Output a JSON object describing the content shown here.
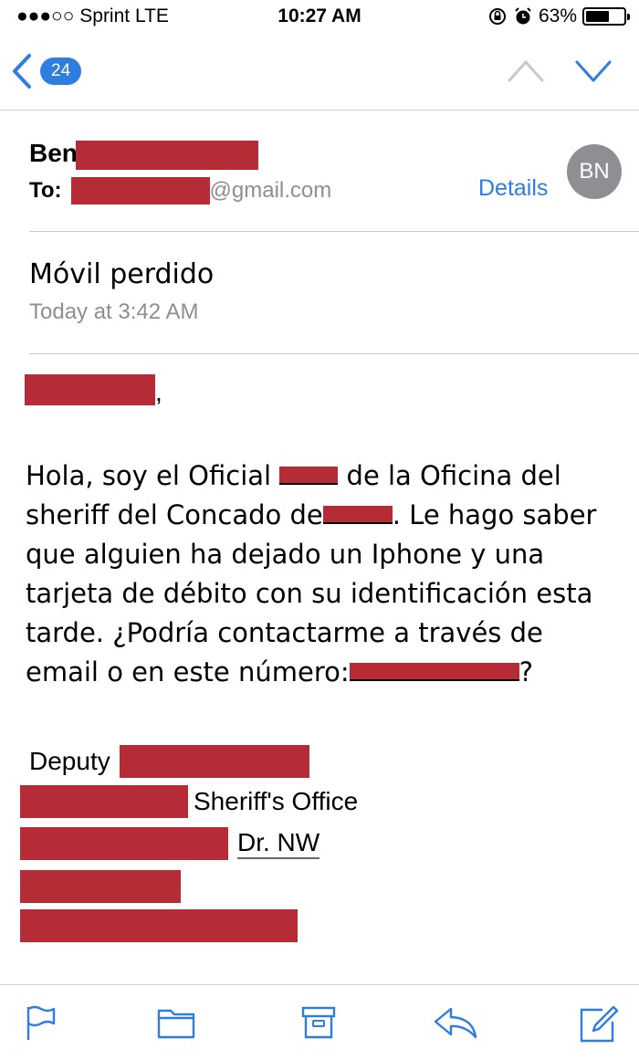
{
  "status_bar": {
    "carrier": "●●●○○ Sprint  LTE",
    "time": "10:27 AM",
    "battery_percent": "63%",
    "battery_level": 0.63
  },
  "nav": {
    "back_count": "24"
  },
  "message": {
    "sender_visible": "Ben",
    "to_label": "To:",
    "to_domain": "@gmail.com",
    "details_label": "Details",
    "avatar_initials": "BN",
    "subject": "Móvil perdido",
    "date": "Today at 3:42 AM",
    "greeting_comma": ",",
    "body": {
      "l1a": "Hola, soy el Oficial ",
      "l1b": " de la Oficina del",
      "l2a": "sheriff del Concado de",
      "l2b": ". Le hago saber",
      "l3": "que alguien ha dejado un Iphone y una",
      "l4": "tarjeta de débito con su identificación esta",
      "l5": "tarde. ¿Podría contactarme a través de",
      "l6a": "email o en este número:",
      "l6b": "?"
    },
    "signature": {
      "title": "Deputy",
      "office": "Sheriff's Office",
      "street_suffix": "Dr. NW"
    }
  },
  "colors": {
    "accent": "#2f7de1",
    "redaction": "#b52b36",
    "secondary_text": "#8e8e93"
  }
}
